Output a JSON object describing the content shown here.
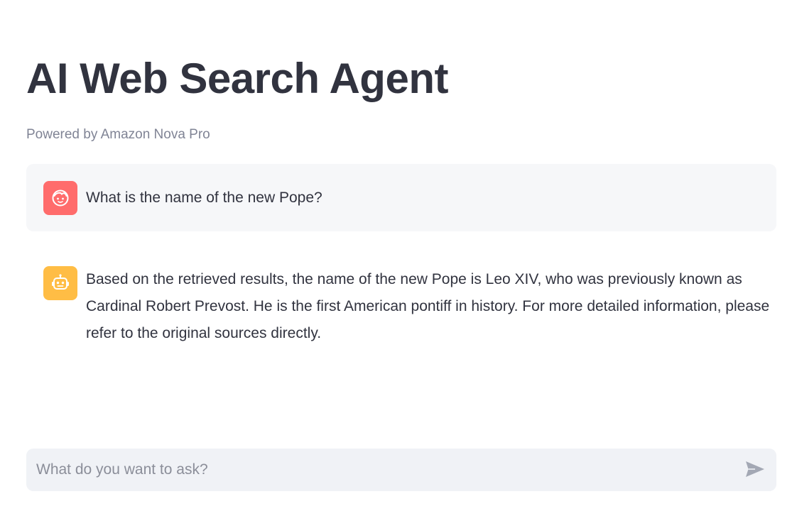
{
  "header": {
    "title": "AI Web Search Agent",
    "subtitle": "Powered by Amazon Nova Pro"
  },
  "messages": [
    {
      "role": "user",
      "avatar_icon": "user-face-icon",
      "avatar_color": "#ff6c6c",
      "text": "What is the name of the new Pope?"
    },
    {
      "role": "assistant",
      "avatar_icon": "robot-icon",
      "avatar_color": "#ffbd45",
      "text": "Based on the retrieved results, the name of the new Pope is Leo XIV, who was previously known as Cardinal Robert Prevost. He is the first American pontiff in history. For more detailed information, please refer to the original sources directly."
    }
  ],
  "chat_input": {
    "placeholder": "What do you want to ask?",
    "value": "",
    "send_icon": "send-arrow-icon"
  },
  "colors": {
    "text": "#31333f",
    "muted": "#808495",
    "user_bubble_bg": "#f6f7f9",
    "input_bg": "#f0f2f6"
  }
}
